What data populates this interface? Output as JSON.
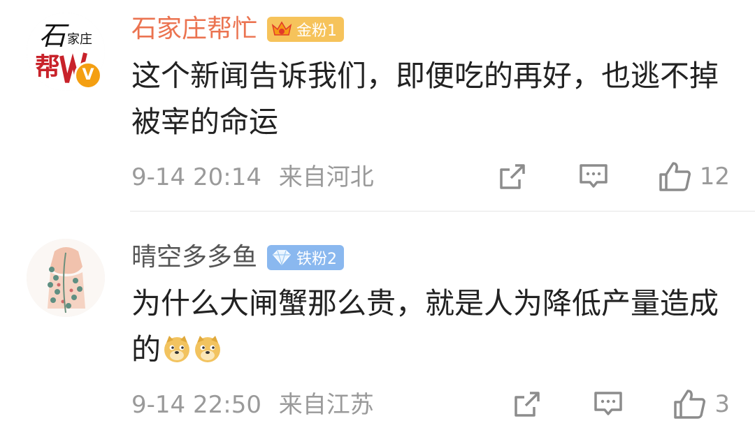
{
  "comments": [
    {
      "username": "石家庄帮忙",
      "badge_label": "金粉1",
      "badge_icon": "crown-icon",
      "verified": "V",
      "avatar_text_main": "石",
      "avatar_text_sub": "家庄",
      "avatar_text_logo": "帮",
      "text": "这个新闻告诉我们，即便吃的再好，也逃不掉被宰的命运",
      "time": "9-14 20:14",
      "location": "来自河北",
      "likes": "12",
      "colors": {
        "username": "#eb7350",
        "badge": "#f6c35b"
      }
    },
    {
      "username": "晴空多多鱼",
      "badge_label": "铁粉2",
      "badge_icon": "diamond-icon",
      "text": "为什么大闸蟹那么贵，就是人为降低产量造成的",
      "emojis": [
        "doge-emoji",
        "doge-emoji"
      ],
      "time": "9-14 22:50",
      "location": "来自江苏",
      "likes": "3",
      "colors": {
        "username": "#555555",
        "badge": "#8ab8ef"
      }
    }
  ],
  "icons": {
    "share": "share-icon",
    "comment": "comment-icon",
    "like": "thumbs-up-icon"
  }
}
